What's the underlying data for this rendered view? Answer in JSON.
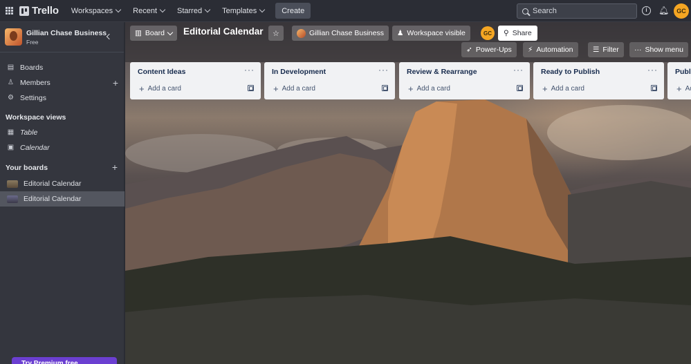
{
  "topbar": {
    "logo": "Trello",
    "menus": [
      {
        "label": "Workspaces"
      },
      {
        "label": "Recent"
      },
      {
        "label": "Starred"
      },
      {
        "label": "Templates"
      }
    ],
    "create_label": "Create",
    "search_placeholder": "Search",
    "user_initials": "GC"
  },
  "sidebar": {
    "workspace_name": "Gillian Chase Business",
    "workspace_plan": "Free",
    "items": [
      {
        "label": "Boards",
        "icon": "board-icon"
      },
      {
        "label": "Members",
        "icon": "person-icon"
      },
      {
        "label": "Settings",
        "icon": "gear-icon"
      }
    ],
    "views_heading": "Workspace views",
    "views": [
      {
        "label": "Table",
        "icon": "table-icon"
      },
      {
        "label": "Calendar",
        "icon": "calendar-icon"
      }
    ],
    "boards_heading": "Your boards",
    "boards": [
      {
        "label": "Editorial Calendar"
      },
      {
        "label": "Editorial Calendar"
      }
    ],
    "premium_label": "Try Premium free"
  },
  "board": {
    "view_label": "Board",
    "title": "Editorial Calendar",
    "workspace_label": "Gillian Chase Business",
    "visibility_label": "Workspace visible",
    "member_initials": "GC",
    "share_label": "Share",
    "powerups_label": "Power-Ups",
    "automation_label": "Automation",
    "filter_label": "Filter",
    "menu_label": "Show menu",
    "add_card_label": "Add a card",
    "lists": [
      {
        "title": "Content Ideas"
      },
      {
        "title": "In Development"
      },
      {
        "title": "Review & Rearrange"
      },
      {
        "title": "Ready to Publish"
      },
      {
        "title": "Publi"
      }
    ]
  }
}
